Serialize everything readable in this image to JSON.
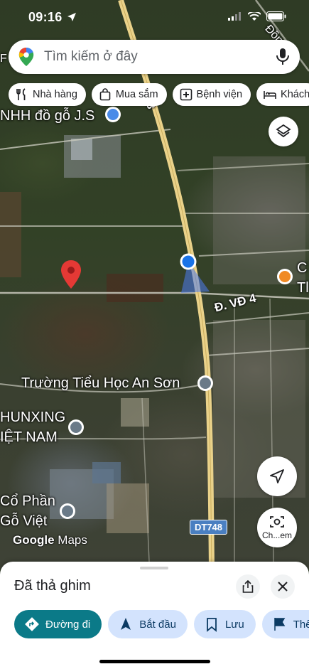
{
  "status_bar": {
    "time": "09:16"
  },
  "search": {
    "placeholder": "Tìm kiếm ở đây"
  },
  "chips": [
    "Nhà hàng",
    "Mua sắm",
    "Bệnh viện",
    "Khách"
  ],
  "map_labels": {
    "company_jS": "NHH đồ gỗ J.S",
    "school": "Trường Tiểu Học An Sơn",
    "hunxing_1": "HUNXING",
    "hunxing_2": "IỆT NAM",
    "coph_1": "Cổ Phần",
    "coph_2": "Gỗ Việt",
    "poi_c": "C",
    "poi_t": "Tl",
    "road_vd4": "Đ. VĐ 4",
    "road_748": "748",
    "road_top": "Đồng T",
    "road_dt748": "DT748",
    "top_left": "F"
  },
  "watermark": {
    "brand": "Google",
    "suffix": "Maps"
  },
  "lens_label": "Ch...em",
  "sheet": {
    "title": "Đã thả ghim",
    "actions": [
      "Đường đi",
      "Bắt đầu",
      "Lưu",
      "Thê"
    ]
  },
  "colors": {
    "primary": "#0b7a88",
    "secondary": "#d3e3fd",
    "pin": "#e53935",
    "location": "#1a73e8"
  }
}
